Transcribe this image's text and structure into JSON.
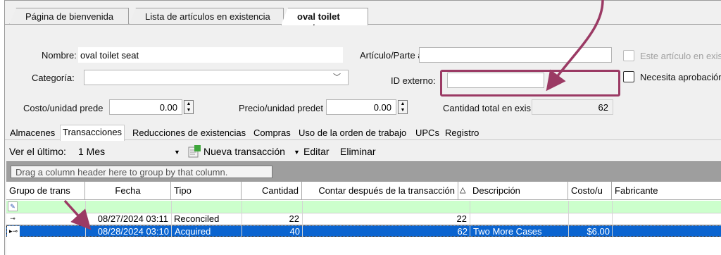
{
  "doc_tabs": [
    {
      "label": "Página de bienvenida"
    },
    {
      "label": "Lista de artículos en existencia"
    },
    {
      "label": "oval toilet seat",
      "active": true
    }
  ],
  "form": {
    "nombre_label": "Nombre:",
    "nombre_value": "oval toilet seat",
    "articulo_label": "Artículo/Parte a",
    "articulo_value": "",
    "este_articulo_label": "Este artículo en exist",
    "categoria_label": "Categoría:",
    "categoria_value": "",
    "id_externo_label": "ID externo:",
    "id_externo_value": "",
    "necesita_label": "Necesita aprobación",
    "costo_label": "Costo/unidad  prede",
    "costo_value": "0.00",
    "precio_label": "Precio/unidad predet",
    "precio_value": "0.00",
    "cantidad_label": "Cantidad total en exis",
    "cantidad_value": "62"
  },
  "inner_tabs": [
    {
      "label": "Almacenes"
    },
    {
      "label": "Transacciones",
      "active": true
    },
    {
      "label": "Reducciones de existencias"
    },
    {
      "label": "Compras"
    },
    {
      "label": "Uso de la orden de trabajo"
    },
    {
      "label": "UPCs"
    },
    {
      "label": "Registro"
    }
  ],
  "toolbar": {
    "ver_label": "Ver el último:",
    "period_value": "1 Mes",
    "new_label": "Nueva transacción",
    "edit_label": "Editar",
    "delete_label": "Eliminar"
  },
  "grid": {
    "group_hint": "Drag a column header here to group by that column.",
    "columns": [
      "Grupo de trans",
      "Fecha",
      "Tipo",
      "Cantidad",
      "Contar después de la transacción",
      "Descripción",
      "Costo/u",
      "Fabricante"
    ],
    "rows": [
      {
        "fecha": "08/27/2024 03:11",
        "tipo": "Reconciled",
        "cantidad": "22",
        "contar": "22",
        "descripcion": "",
        "costo": "",
        "fabricante": ""
      },
      {
        "fecha": "08/28/2024 03:10",
        "tipo": "Acquired",
        "cantidad": "40",
        "contar": "62",
        "descripcion": "Two More Cases",
        "costo": "$6.00",
        "fabricante": ""
      }
    ]
  },
  "colors": {
    "annotation": "#9b3a64",
    "selected_row": "#0a64d0",
    "new_row": "#ccffcc"
  }
}
